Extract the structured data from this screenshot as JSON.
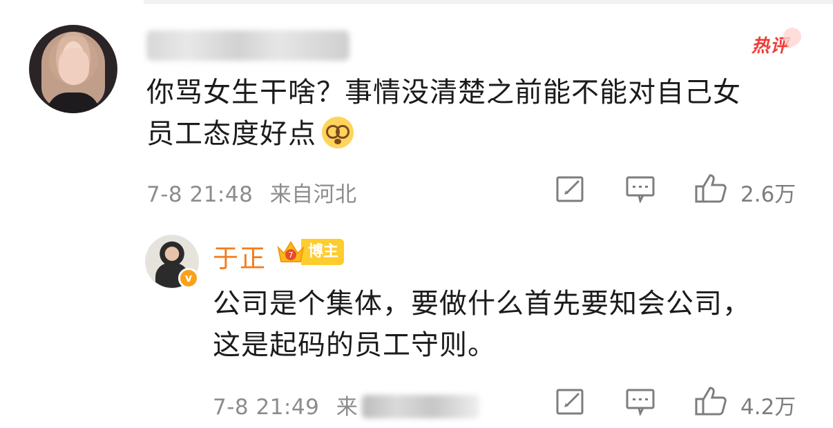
{
  "comment": {
    "text_line1": "你骂女生干啥？事情没清楚之前能不能对自己女",
    "text_line2": "员工态度好点",
    "emoji_icon": "dizzy-face-emoji",
    "badge": "热评",
    "time": "7-8 21:48",
    "location": "来自河北",
    "likes": "2.6万"
  },
  "reply": {
    "username": "于正",
    "badge_label": "博主",
    "badge_level": "7",
    "text_line1": "公司是个集体，要做什么首先要知会公司，",
    "text_line2": "这是起码的员工守则。",
    "time": "7-8 21:49",
    "location_prefix": "来",
    "likes": "4.2万"
  },
  "colors": {
    "accent_orange": "#f37b1d",
    "hot_red": "#ef3b36",
    "badge_yellow": "#ffcc2e",
    "meta_gray": "#8c8c8c"
  },
  "icons": [
    "edit-icon",
    "comment-icon",
    "like-icon",
    "verified-icon",
    "crown-icon"
  ]
}
